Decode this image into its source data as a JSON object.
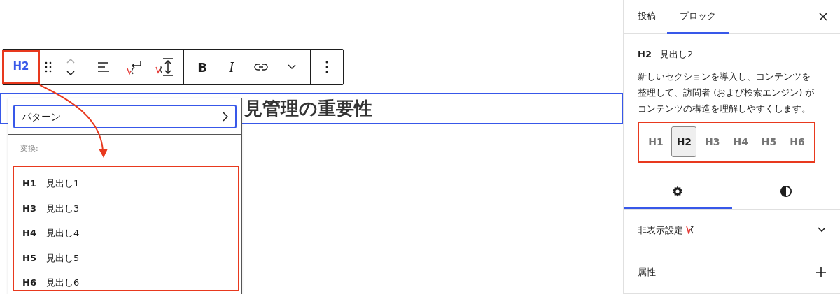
{
  "toolbar": {
    "block_type": "H2",
    "bold": "B",
    "italic": "I"
  },
  "heading": {
    "text": "見管理の重要性"
  },
  "popover": {
    "pattern_button": "パターン",
    "transform_label": "変換:",
    "items": [
      {
        "level": "H1",
        "label": "見出し1"
      },
      {
        "level": "H3",
        "label": "見出し3"
      },
      {
        "level": "H4",
        "label": "見出し4"
      },
      {
        "level": "H5",
        "label": "見出し5"
      },
      {
        "level": "H6",
        "label": "見出し6"
      }
    ]
  },
  "sidebar": {
    "tabs": [
      {
        "label": "投稿",
        "selected": false
      },
      {
        "label": "ブロック",
        "selected": true
      }
    ],
    "block_title": {
      "level": "H2",
      "name": "見出し2"
    },
    "description": "新しいセクションを導入し、コンテンツを整理して、訪問者 (および検索エンジン) がコンテンツの構造を理解しやすくします。",
    "levels": [
      {
        "label": "H1",
        "selected": false
      },
      {
        "label": "H2",
        "selected": true
      },
      {
        "label": "H3",
        "selected": false
      },
      {
        "label": "H4",
        "selected": false
      },
      {
        "label": "H5",
        "selected": false
      },
      {
        "label": "H6",
        "selected": false
      }
    ],
    "icon_tabs": [
      {
        "kind": "settings",
        "selected": true
      },
      {
        "kind": "styles",
        "selected": false
      }
    ],
    "panels": [
      {
        "title": "非表示設定",
        "kind": "chevron",
        "badge": true
      },
      {
        "title": "属性",
        "kind": "plus",
        "badge": false
      }
    ]
  }
}
